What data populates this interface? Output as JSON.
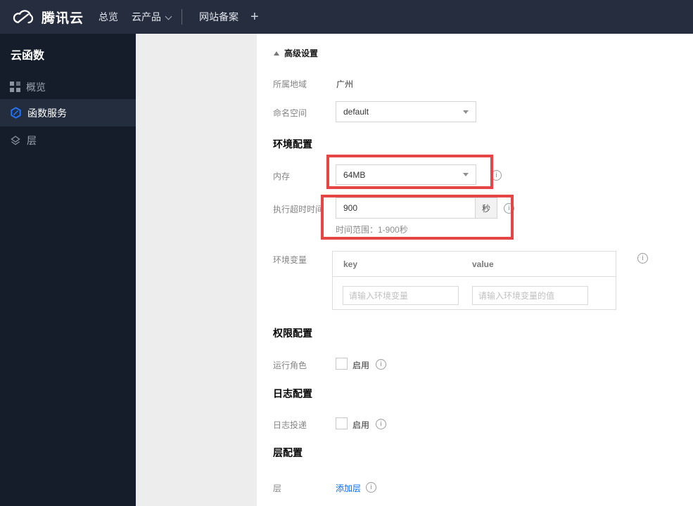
{
  "topbar": {
    "logo_text": "腾讯云",
    "nav_overview": "总览",
    "nav_products": "云产品",
    "nav_beian": "网站备案",
    "nav_plus": "+"
  },
  "sidebar": {
    "title": "云函数",
    "items": [
      {
        "label": "概览"
      },
      {
        "label": "函数服务"
      },
      {
        "label": "层"
      }
    ]
  },
  "panel": {
    "advanced_toggle": "高级设置",
    "region_label": "所属地域",
    "region_value": "广州",
    "namespace_label": "命名空间",
    "namespace_value": "default",
    "env_section": "环境配置",
    "memory_label": "内存",
    "memory_value": "64MB",
    "timeout_label": "执行超时时间",
    "timeout_value": "900",
    "timeout_unit": "秒",
    "timeout_hint": "时间范围：1-900秒",
    "envvar_label": "环境变量",
    "envvar_key_header": "key",
    "envvar_value_header": "value",
    "envvar_key_placeholder": "请输入环境变量",
    "envvar_value_placeholder": "请输入环境变量的值",
    "perm_section": "权限配置",
    "role_label": "运行角色",
    "role_enable": "启用",
    "log_section": "日志配置",
    "log_label": "日志投递",
    "log_enable": "启用",
    "layer_section": "层配置",
    "layer_label": "层",
    "layer_add": "添加层",
    "info_glyph": "i"
  },
  "colors": {
    "highlight_red": "#e54545",
    "link_blue": "#006eff",
    "scf_icon_blue": "#2476ff",
    "topbar_bg": "#252d3f",
    "sidebar_bg": "#151d2a"
  }
}
